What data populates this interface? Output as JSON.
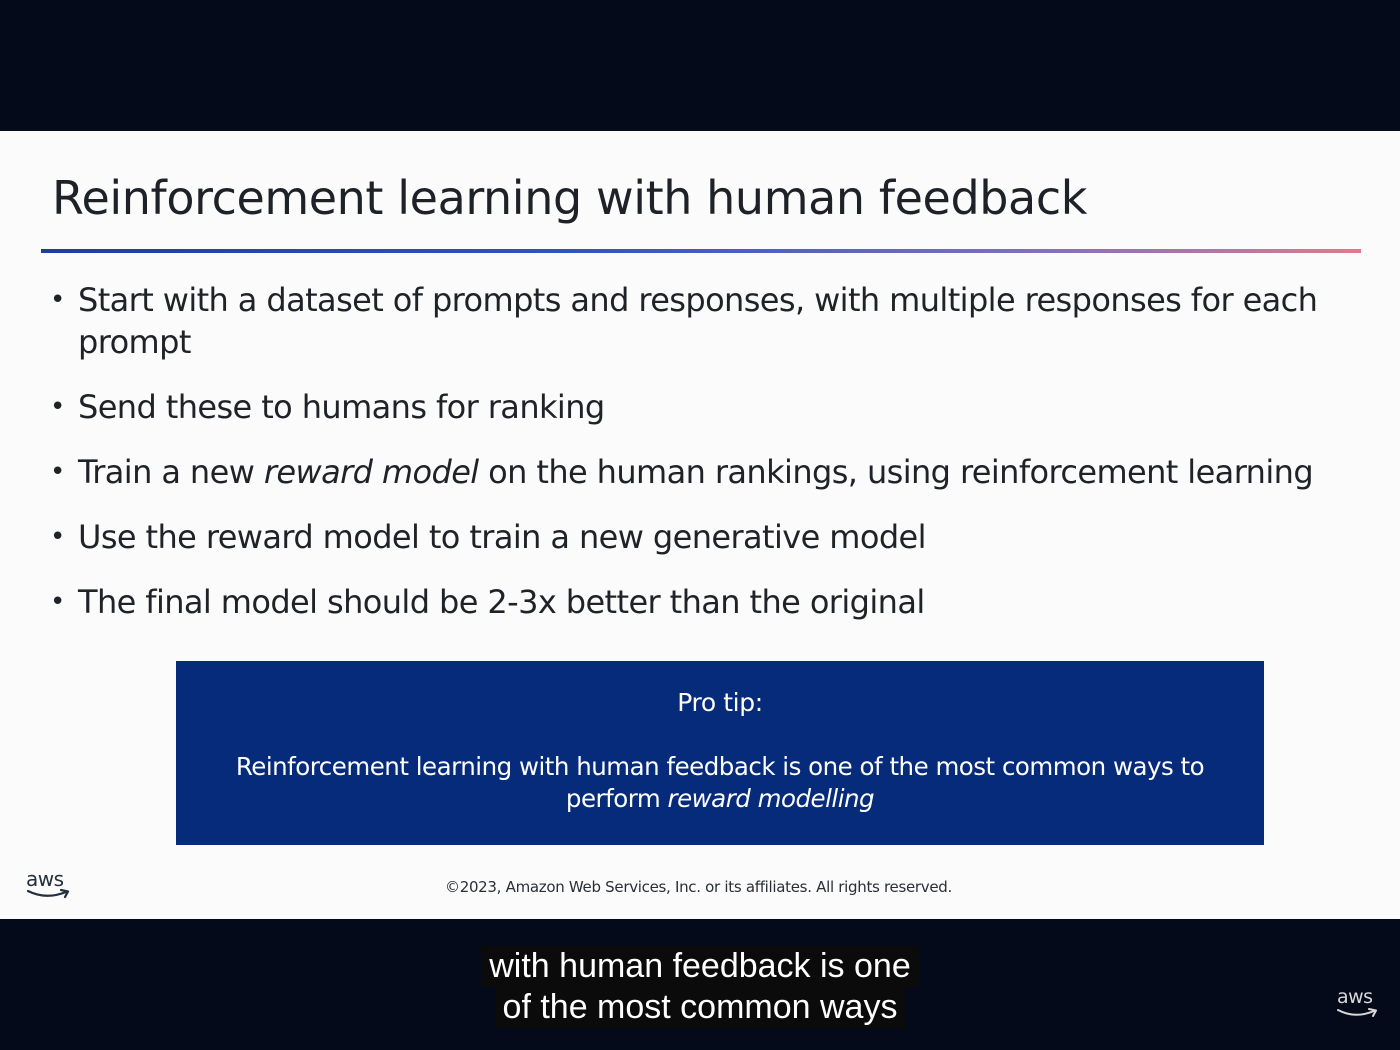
{
  "slide": {
    "title": "Reinforcement learning with human feedback",
    "bullets": [
      {
        "text": "Start with a dataset of prompts and responses, with multiple responses for each prompt"
      },
      {
        "text": "Send these to humans for ranking"
      },
      {
        "pre": "Train a new ",
        "em": "reward model",
        "post": " on the human rankings, using reinforcement learning"
      },
      {
        "text": "Use the reward model to train a new generative model"
      },
      {
        "text": "The final model should be 2-3x better than the original"
      }
    ],
    "bullet_glyph": "•",
    "protip": {
      "heading": "Pro tip:",
      "body_pre": "Reinforcement learning with human feedback is one of the most common ways to perform ",
      "body_em": "reward modelling"
    },
    "logo_text": "aws",
    "copyright": "©2023, Amazon Web Services, Inc. or its affiliates. All rights reserved."
  },
  "captions": {
    "line1": "with human feedback is one",
    "line2": "of the most common ways"
  },
  "corner_logo_text": "aws",
  "colors": {
    "frame_bg": "#050a1a",
    "slide_bg": "#fbfbfb",
    "protip_bg": "#072b7b",
    "title_rule_start": "#1b3f9c",
    "title_rule_end": "#e07a8a"
  }
}
